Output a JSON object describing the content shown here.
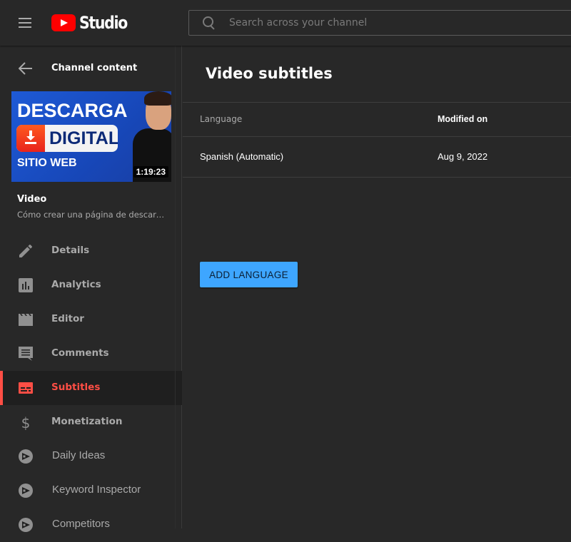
{
  "header": {
    "logo_text": "Studio",
    "search": {
      "placeholder": "Search across your channel",
      "value": ""
    }
  },
  "sidebar": {
    "back_label": "Channel content",
    "thumbnail": {
      "line1": "DESCARGA",
      "line2": "DIGITAL",
      "line3": "SITIO WEB",
      "duration": "1:19:23"
    },
    "video_label": "Video",
    "video_title": "Cómo crear una página de descarga...",
    "items": [
      {
        "label": "Details",
        "icon": "pencil-icon",
        "active": false
      },
      {
        "label": "Analytics",
        "icon": "analytics-icon",
        "active": false
      },
      {
        "label": "Editor",
        "icon": "clapperboard-icon",
        "active": false
      },
      {
        "label": "Comments",
        "icon": "comment-icon",
        "active": false
      },
      {
        "label": "Subtitles",
        "icon": "subtitles-icon",
        "active": true
      },
      {
        "label": "Monetization",
        "icon": "dollar-icon",
        "active": false
      },
      {
        "label": "Daily Ideas",
        "icon": "extension-play-icon",
        "active": false
      },
      {
        "label": "Keyword Inspector",
        "icon": "extension-play-icon",
        "active": false
      },
      {
        "label": "Competitors",
        "icon": "extension-play-icon",
        "active": false
      }
    ],
    "active_color": "#ff4e45"
  },
  "main": {
    "title": "Video subtitles",
    "table": {
      "columns": [
        "Language",
        "Modified on"
      ],
      "rows": [
        {
          "language": "Spanish (Automatic)",
          "modified_on": "Aug 9, 2022"
        }
      ]
    },
    "add_language_label": "ADD LANGUAGE",
    "accent_color": "#3ea6ff"
  }
}
